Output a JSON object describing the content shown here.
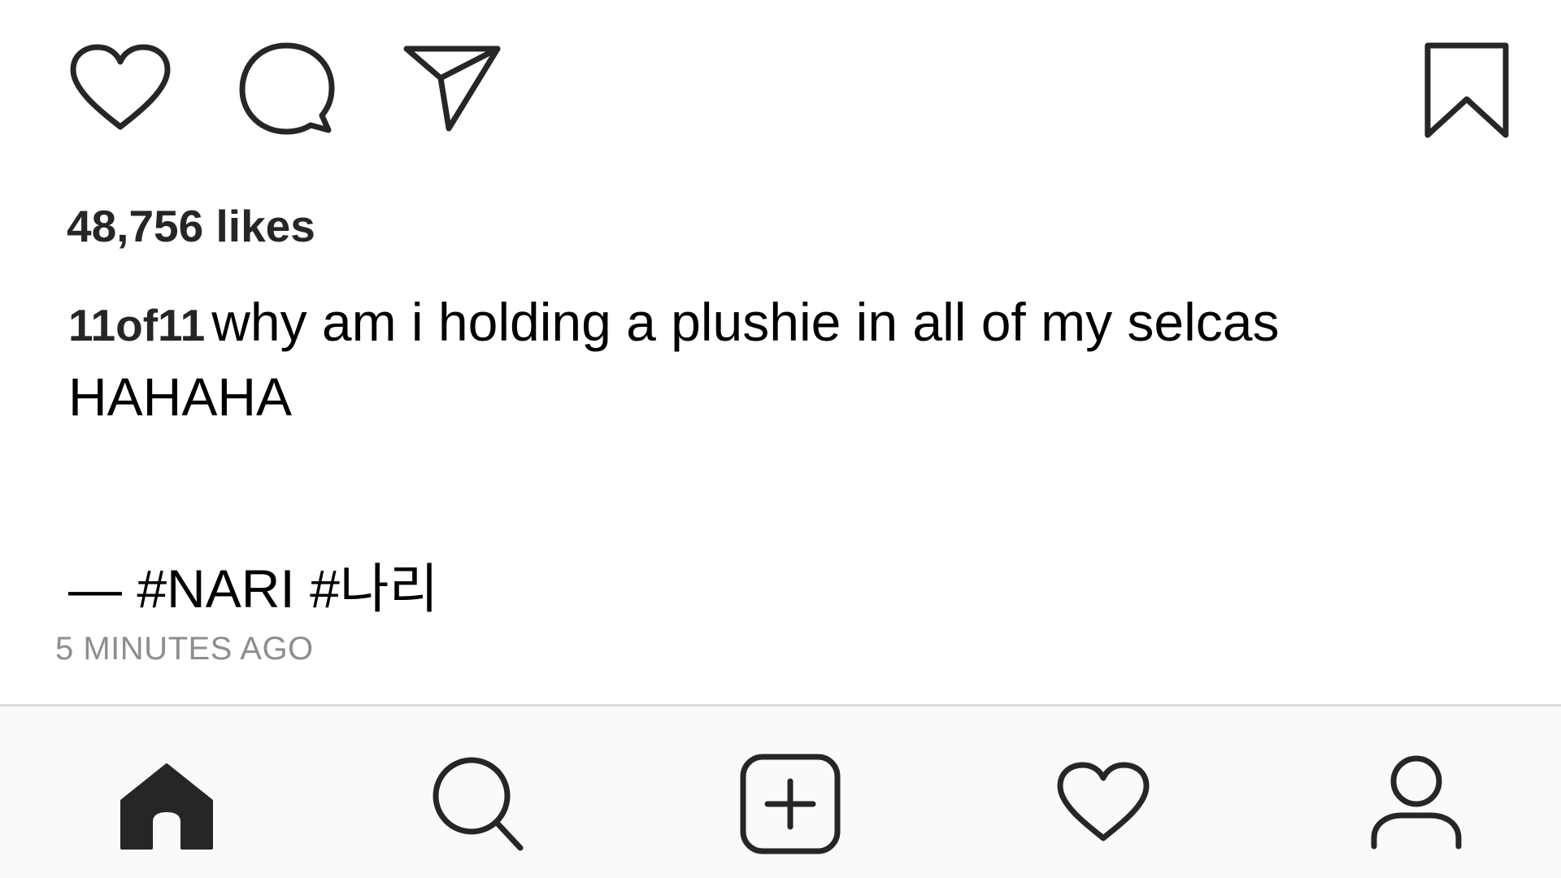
{
  "actions": {
    "like_icon": "heart-icon",
    "comment_icon": "comment-bubble-icon",
    "share_icon": "paper-plane-icon",
    "save_icon": "bookmark-icon"
  },
  "post": {
    "likes": "48,756 likes",
    "username": "11of11",
    "caption_line1": "why am i holding a plushie in all of my selcas",
    "caption_line2": "HAHAHA",
    "tags": "— #NARI #나리",
    "timestamp": "5 MINUTES AGO"
  },
  "tab_bar": {
    "tabs": [
      {
        "icon": "home-icon",
        "active": true
      },
      {
        "icon": "search-icon",
        "active": false
      },
      {
        "icon": "new-post-icon",
        "active": false
      },
      {
        "icon": "activity-heart-icon",
        "active": false
      },
      {
        "icon": "profile-icon",
        "active": false
      }
    ],
    "background": "#fafafa",
    "border": "#dbdbdb"
  },
  "colors": {
    "icon_stroke": "#262626",
    "text_primary": "#000000",
    "text_secondary": "#8e8e8e"
  }
}
